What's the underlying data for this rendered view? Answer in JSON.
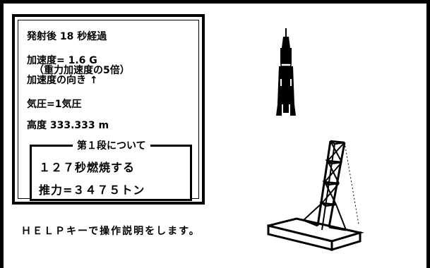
{
  "info": {
    "title": "発射後 18 秒経過",
    "acceleration": "加速度= 1.6 G",
    "acceleration_note": "（重力加速度の5倍）",
    "acceleration_direction": "加速度の向き ↑",
    "pressure": "気圧=1気圧",
    "altitude": "高度 333.333 m"
  },
  "stage": {
    "legend": "第１段について",
    "burn": "１２７秒燃焼する",
    "thrust": "推力=３４７５トン"
  },
  "help_text": "ＨＥＬＰキーで操作説明をします。"
}
